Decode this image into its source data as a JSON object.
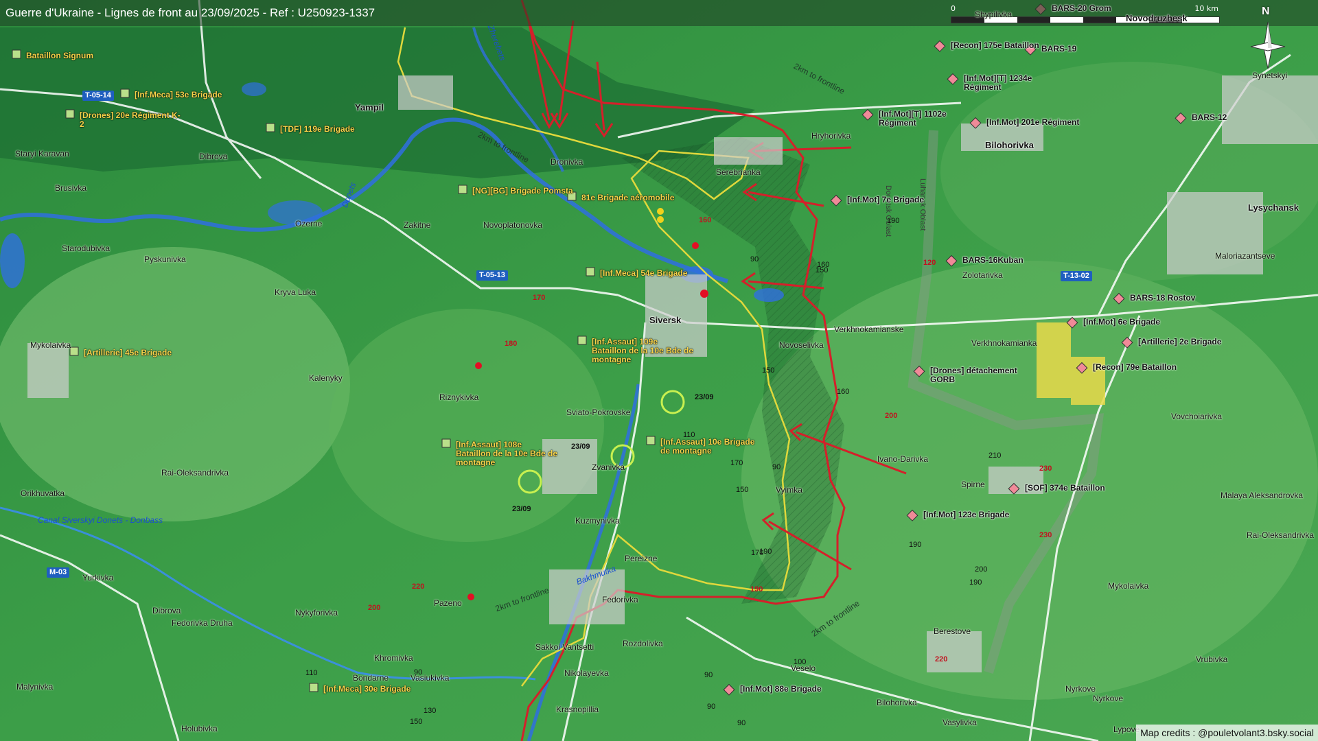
{
  "title": "Guerre d'Ukraine - Lignes de front au 23/09/2025 - Ref : U250923-1337",
  "scale": {
    "start": "0",
    "end": "10 km"
  },
  "compass": {
    "label": "N"
  },
  "credits": "Map credits : @pouletvolant3.bsky.social",
  "colors": {
    "front": "#d4202a",
    "ua_zone": "#e0d83c",
    "water": "#2f6fe0",
    "russian_unit": "#f08a98",
    "ukrainian_unit": "#b9e08a"
  },
  "places": [
    {
      "name": "Yampil",
      "style": "town"
    },
    {
      "name": "Siversk",
      "style": "town"
    },
    {
      "name": "Bilohorivka",
      "style": "town"
    },
    {
      "name": "Lysychansk",
      "style": "town"
    },
    {
      "name": "Novodruzhesk",
      "style": "town"
    },
    {
      "name": "Dronivka"
    },
    {
      "name": "Zakitne"
    },
    {
      "name": "Novoplatonovka"
    },
    {
      "name": "Ozerne"
    },
    {
      "name": "Starodubivka"
    },
    {
      "name": "Pyskunivka"
    },
    {
      "name": "Kryva Luka"
    },
    {
      "name": "Staryi Karavan"
    },
    {
      "name": "Brusivka"
    },
    {
      "name": "Dibrova"
    },
    {
      "name": "Serebrianka"
    },
    {
      "name": "Hryhorivka"
    },
    {
      "name": "Mykolaivka"
    },
    {
      "name": "Kalenyky"
    },
    {
      "name": "Riznykivka"
    },
    {
      "name": "Sviato-Pokrovske"
    },
    {
      "name": "Verkhnokamianske"
    },
    {
      "name": "Novoselivka"
    },
    {
      "name": "Zvanivka"
    },
    {
      "name": "Rai-Oleksandrivka"
    },
    {
      "name": "Orikhuvatka"
    },
    {
      "name": "Kuzmynivka"
    },
    {
      "name": "Pereizne"
    },
    {
      "name": "Ivano-Darivka"
    },
    {
      "name": "Vyimka"
    },
    {
      "name": "Spirne"
    },
    {
      "name": "Zolotarivka"
    },
    {
      "name": "Verkhnokamianka"
    },
    {
      "name": "Maloriazantseve"
    },
    {
      "name": "Vovchoiarivka"
    },
    {
      "name": "Malaya Aleksandrovka"
    },
    {
      "name": "Rai-Oleksandrivka"
    },
    {
      "name": "Mykolaivka"
    },
    {
      "name": "Yurkivka"
    },
    {
      "name": "Dibrova"
    },
    {
      "name": "Fedorivka Druha"
    },
    {
      "name": "Nykyforivka"
    },
    {
      "name": "Pazeno"
    },
    {
      "name": "Fedorivka"
    },
    {
      "name": "Khromivka"
    },
    {
      "name": "Bondarne"
    },
    {
      "name": "Vasiukivka"
    },
    {
      "name": "Sakkoi Vantsetti"
    },
    {
      "name": "Rozdolivka"
    },
    {
      "name": "Nikolayevka"
    },
    {
      "name": "Malynivka"
    },
    {
      "name": "Holubivka"
    },
    {
      "name": "Krasnopillia"
    },
    {
      "name": "Veselo"
    },
    {
      "name": "Bilohorivka"
    },
    {
      "name": "Berestove"
    },
    {
      "name": "Nyrkove"
    },
    {
      "name": "Nyrkove"
    },
    {
      "name": "Vasylivka"
    },
    {
      "name": "Lypove"
    },
    {
      "name": "Vrubivka"
    },
    {
      "name": "Synetskyi"
    },
    {
      "name": "Shypilivka"
    }
  ],
  "water_labels": [
    "Donets",
    "Zherebets",
    "Bakhmutka",
    "Canal Siverskyi Donets - Donbass"
  ],
  "roads": [
    "T-05-14",
    "T-05-13",
    "T-13-02",
    "M-03"
  ],
  "region_labels": [
    "Luhansk Oblast",
    "Donetsk Oblast"
  ],
  "distance_labels": [
    "2km to frontline",
    "2km to frontline",
    "2km to frontline",
    "2km to frontline"
  ],
  "elevations_red": [
    "160",
    "170",
    "180",
    "200",
    "220",
    "200",
    "230",
    "230",
    "220",
    "190",
    "120"
  ],
  "elevations": [
    "90",
    "150",
    "160",
    "190",
    "150",
    "160",
    "170",
    "110",
    "150",
    "170",
    "90",
    "210",
    "190",
    "190",
    "200",
    "150",
    "130",
    "110",
    "90",
    "100",
    "90",
    "90",
    "90",
    "190"
  ],
  "dates": [
    "23/09",
    "23/09",
    "23/09"
  ],
  "ua_units": [
    {
      "text": "Bataillon Signum"
    },
    {
      "text": "[Inf.Meca] 53e Brigade"
    },
    {
      "text": "[Drones] 20e Régiment K-2"
    },
    {
      "text": "[TDF] 119e Brigade"
    },
    {
      "text": "[NG][BG] Brigade Pomsta"
    },
    {
      "text": "81e Brigade aéromobile"
    },
    {
      "text": "[Inf.Meca] 54e Brigade"
    },
    {
      "text": "[Inf.Assaut] 109e Bataillon de la 10e Bde de montagne"
    },
    {
      "text": "[Inf.Assaut] 108e Bataillon de la 10e Bde de montagne"
    },
    {
      "text": "[Inf.Assaut] 10e Brigade de montagne"
    },
    {
      "text": "[Artillerie] 45e Brigade"
    },
    {
      "text": "[Inf.Meca] 30e Brigade"
    }
  ],
  "ru_units": [
    {
      "text": "BARS-20 Grom"
    },
    {
      "text": "[Recon] 175e Bataillon"
    },
    {
      "text": "BARS-19"
    },
    {
      "text": "[Inf.Mot][T] 1234e Régiment"
    },
    {
      "text": "[Inf.Mot][T] 1102e Régiment"
    },
    {
      "text": "[Inf.Mot] 201e Régiment"
    },
    {
      "text": "BARS-12"
    },
    {
      "text": "[Inf.Mot] 7e Brigade"
    },
    {
      "text": "BARS-16Kuban"
    },
    {
      "text": "BARS-18 Rostov"
    },
    {
      "text": "[Inf.Mot] 6e Brigade"
    },
    {
      "text": "[Artillerie] 2e Brigade"
    },
    {
      "text": "[Drones] détachement GORB"
    },
    {
      "text": "[Recon] 79e Bataillon"
    },
    {
      "text": "[SOF] 374e Bataillon"
    },
    {
      "text": "[Inf.Mot] 123e Brigade"
    },
    {
      "text": "[Inf.Mot] 88e Brigade"
    }
  ]
}
